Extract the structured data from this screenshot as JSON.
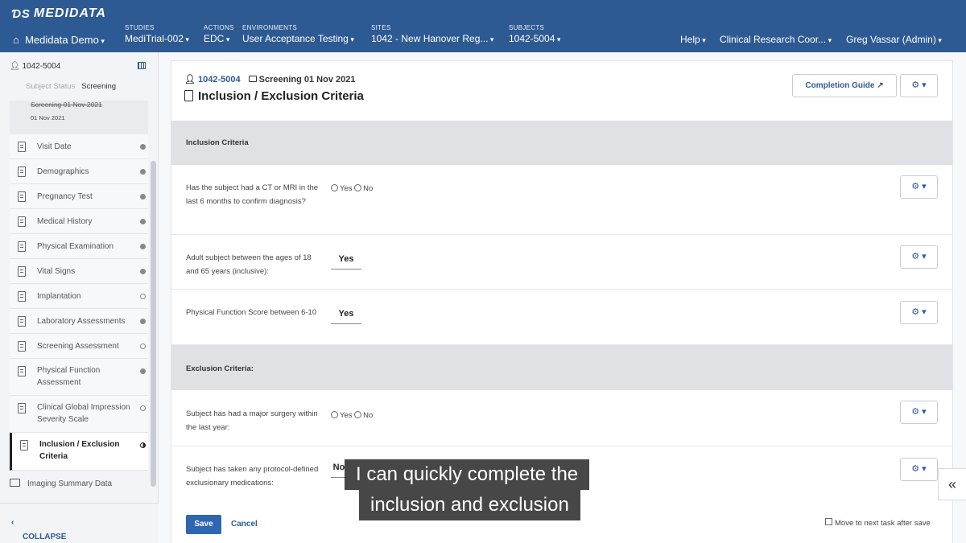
{
  "header": {
    "brand": "MEDIDATA",
    "home_label": "Medidata Demo",
    "studies": {
      "caption": "STUDIES",
      "value": "MediTrial-002"
    },
    "actions": {
      "caption": "ACTIONS",
      "value": "EDC"
    },
    "environments": {
      "caption": "ENVIRONMENTS",
      "value": "User Acceptance Testing"
    },
    "sites": {
      "caption": "SITES",
      "value": "1042 - New Hanover Reg..."
    },
    "subjects": {
      "caption": "SUBJECTS",
      "value": "1042-5004"
    },
    "help": "Help",
    "role": "Clinical Research Coor...",
    "user": "Greg Vassar (Admin)"
  },
  "sidebar": {
    "subject": "1042-5004",
    "status_label": "Subject Status",
    "status_value": "Screening",
    "folder_title": "Screening 01 Nov 2021",
    "folder_date": "01 Nov 2021",
    "items": [
      {
        "label": "Visit Date",
        "status": "filled"
      },
      {
        "label": "Demographics",
        "status": "filled"
      },
      {
        "label": "Pregnancy Test",
        "status": "filled"
      },
      {
        "label": "Medical History",
        "status": "filled"
      },
      {
        "label": "Physical Examination",
        "status": "filled"
      },
      {
        "label": "Vital Signs",
        "status": "filled"
      },
      {
        "label": "Implantation",
        "status": "empty"
      },
      {
        "label": "Laboratory Assessments",
        "status": "filled"
      },
      {
        "label": "Screening Assessment",
        "status": "empty"
      },
      {
        "label": "Physical Function Assessment",
        "status": "filled"
      },
      {
        "label": "Clinical Global Impression Severity Scale",
        "status": "empty"
      },
      {
        "label": "Inclusion / Exclusion Criteria",
        "status": "half"
      }
    ],
    "imaging": "Imaging Summary Data",
    "collapse": "COLLAPSE"
  },
  "main": {
    "crumb_subject": "1042-5004",
    "crumb_folder": "Screening 01 Nov 2021",
    "title": "Inclusion / Exclusion Criteria",
    "completion_guide": "Completion Guide",
    "sections": {
      "inclusion": "Inclusion Criteria",
      "exclusion": "Exclusion Criteria:"
    },
    "questions": [
      {
        "text": "Has the subject had a CT or MRI in the last 6 months to confirm diagnosis?",
        "yes": "Yes",
        "no": "No"
      },
      {
        "text": "Adult subject between the ages of 18 and 65 years (inclusive):",
        "answer": "Yes"
      },
      {
        "text": "Physical Function Score between 6-10",
        "answer": "Yes"
      },
      {
        "text": "Subject has had a major surgery within the last year:",
        "yes": "Yes",
        "no": "No"
      },
      {
        "text": "Subject has taken any protocol-defined exclusionary medications:",
        "answer": "No"
      }
    ],
    "save": "Save",
    "cancel": "Cancel",
    "move_next": "Move to next task after save"
  },
  "caption": {
    "line1": "I can quickly complete the",
    "line2": "inclusion and exclusion"
  }
}
